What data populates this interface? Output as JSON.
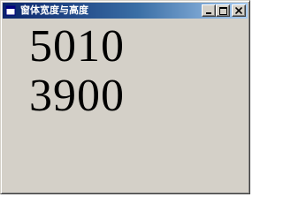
{
  "window": {
    "title": "窗体宽度与高度"
  },
  "title_buttons": {
    "minimize_icon": "minimize-icon",
    "maximize_icon": "maximize-icon",
    "close_icon": "close-icon"
  },
  "content": {
    "width_value": "5010",
    "height_value": "3900"
  },
  "colors": {
    "window_face": "#d4d0c8",
    "titlebar_start": "#0a246a",
    "titlebar_end": "#a6caf0",
    "text": "#000000"
  }
}
